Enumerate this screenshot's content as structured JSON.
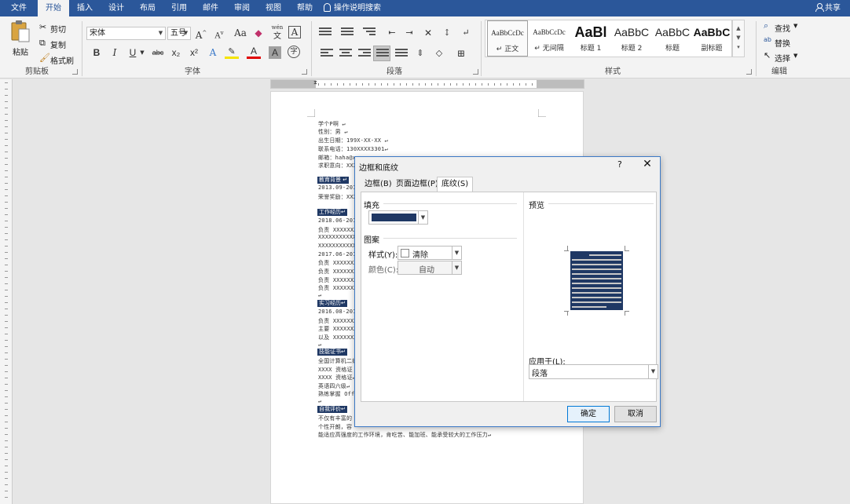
{
  "tabs": [
    "文件",
    "开始",
    "插入",
    "设计",
    "布局",
    "引用",
    "邮件",
    "审阅",
    "视图",
    "帮助"
  ],
  "active_tab": "开始",
  "tell_me": "操作说明搜索",
  "share": "共享",
  "clipboard": {
    "paste": "粘贴",
    "cut": "剪切",
    "copy": "复制",
    "format_painter": "格式刷",
    "label": "剪贴板"
  },
  "font": {
    "name": "宋体",
    "size": "五号",
    "label": "字体",
    "size_up": "A",
    "size_down": "A",
    "case": "Aa",
    "phonetic_top": "wén",
    "phonetic": "文",
    "border_char": "A",
    "bold": "B",
    "italic": "I",
    "underline": "U",
    "strike": "abc",
    "sub": "x₂",
    "sup": "x²",
    "effects": "A",
    "color": "A",
    "shading": "A",
    "enclose": "字"
  },
  "paragraph": {
    "label": "段落"
  },
  "styles": {
    "label": "样式",
    "items": [
      {
        "preview": "AaBbCcDc",
        "name": "↵ 正文"
      },
      {
        "preview": "AaBbCcDc",
        "name": "↵ 无间隔"
      },
      {
        "preview": "AaBl",
        "name": "标题 1"
      },
      {
        "preview": "AaBbC",
        "name": "标题 2"
      },
      {
        "preview": "AaBbC",
        "name": "标题"
      },
      {
        "preview": "AaBbC",
        "name": "副标题"
      }
    ]
  },
  "editing": {
    "find": "查找",
    "replace": "替换",
    "select": "选择",
    "label": "编辑"
  },
  "document": {
    "lines": [
      "学个P啊 ↵",
      "性别：男             ↵",
      "出生日期：199X-XX-XX ↵",
      "联系电话：130XXXX3301↵",
      "邮箱：haha@xuexeon.com ↵",
      "求职意向：XXX"
    ],
    "sections": [
      {
        "head": "教育背景 ↵",
        "lines": [
          "2013.09-2017.",
          "荣誉奖励：XXX"
        ]
      },
      {
        "head": "工作经历↵",
        "lines": [
          "2018.06-2019.",
          "负责 XXXXXXXX",
          "XXXXXXXXXXXX",
          "XXXXXXXXXXXX",
          "2017.06-2018.",
          "负责 XXXXXXXX",
          "负责 XXXXXXXX",
          "负责 XXXXXXXX",
          "负责 XXXXXXXX",
          "↵"
        ]
      },
      {
        "head": "实习经历↵",
        "lines": [
          "2016.08-2017.",
          "负责 XXXXXXXX",
          "主要 XXXXXXXX",
          "以及 XXXXXXXX",
          "↵"
        ]
      },
      {
        "head": "技能证书↵",
        "lines": [
          "全国计算机二级",
          "XXXX 资格证 ↵",
          "XXXX 资格证↵",
          "英语四六级↵",
          "熟练掌握 Offic",
          "↵"
        ]
      },
      {
        "head": "自我评价↵",
        "lines": [
          "不仅有丰富的",
          "个性开朗，容",
          "能适应高强度的工作环境，肯吃苦、能加班、能承受较大的工作压力↵"
        ]
      }
    ]
  },
  "dialog": {
    "title": "边框和底纹",
    "help": "?",
    "close": "✕",
    "tabs": [
      "边框(B)",
      "页面边框(P)",
      "底纹(S)"
    ],
    "active_tab": "底纹(S)",
    "fill_label": "填充",
    "fill_color": "#1f3864",
    "pattern_label": "图案",
    "style_label": "样式(Y):",
    "style_value": "清除",
    "color_label": "颜色(C):",
    "color_value": "自动",
    "preview_label": "预览",
    "apply_label": "应用于(L):",
    "apply_value": "段落",
    "ok": "确定",
    "cancel": "取消"
  }
}
